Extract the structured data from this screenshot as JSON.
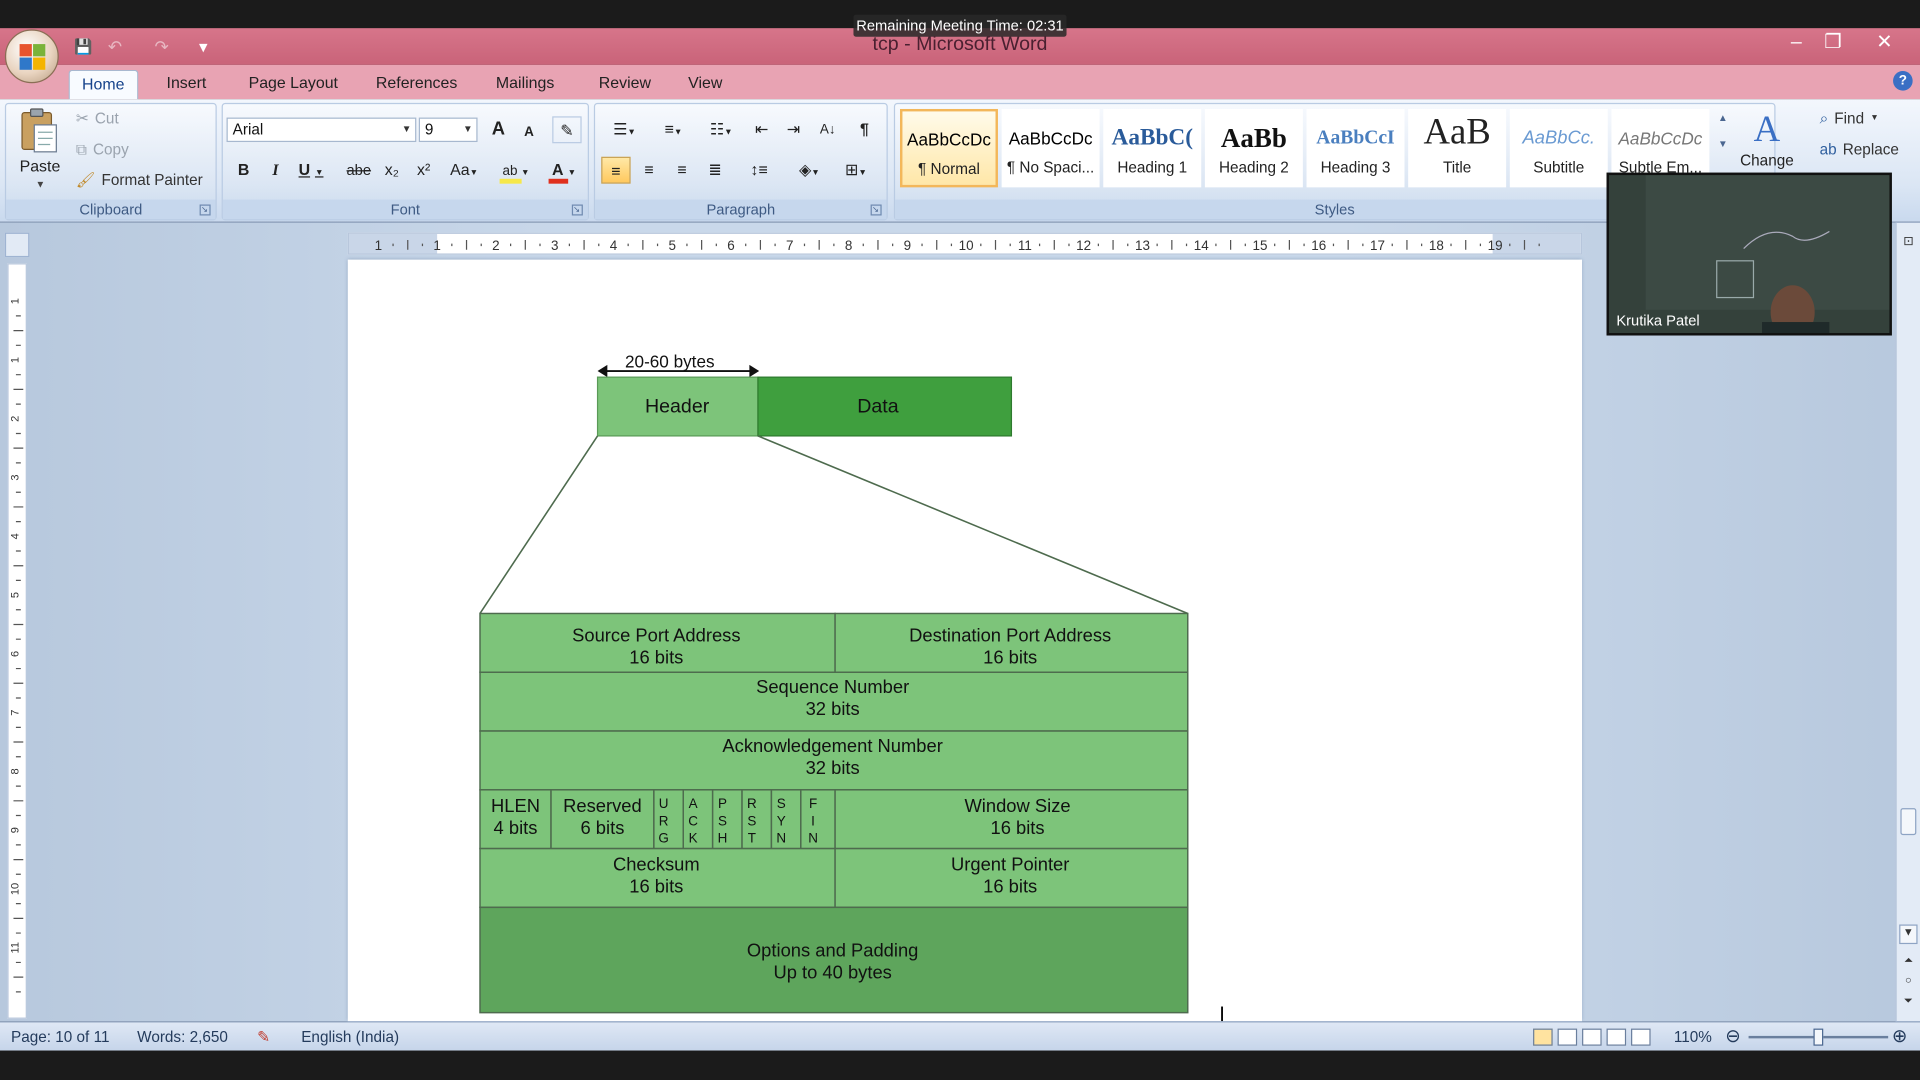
{
  "meeting": {
    "banner": "Remaining Meeting Time: 02:31",
    "participant": "Krutika Patel"
  },
  "window": {
    "title": "tcp - Microsoft Word",
    "minimize": "–",
    "restore": "❐",
    "close": "✕"
  },
  "qat": {
    "save": "💾",
    "undo": "↶",
    "redo": "↷",
    "customize": "▾"
  },
  "tabs": [
    "Home",
    "Insert",
    "Page Layout",
    "References",
    "Mailings",
    "Review",
    "View"
  ],
  "clipboard": {
    "paste": "Paste",
    "cut": "Cut",
    "copy": "Copy",
    "format_painter": "Format Painter",
    "label": "Clipboard"
  },
  "font": {
    "name": "Arial",
    "size": "9",
    "label": "Font",
    "bold": "B",
    "italic": "I",
    "underline": "U",
    "strike": "abe",
    "sub": "x₂",
    "sup": "x²",
    "case": "Aa",
    "grow": "A",
    "shrink": "A",
    "highlight_color": "#f6e84a",
    "font_color": "#e0301e"
  },
  "paragraph": {
    "label": "Paragraph"
  },
  "styles": {
    "label": "Styles",
    "items": [
      {
        "sample": "AaBbCcDc",
        "name": "¶ Normal",
        "selected": true
      },
      {
        "sample": "AaBbCcDc",
        "name": "¶ No Spaci...",
        "selected": false
      },
      {
        "sample": "AaBbC(",
        "name": "Heading 1",
        "selected": false
      },
      {
        "sample": "AaBb",
        "name": "Heading 2",
        "selected": false
      },
      {
        "sample": "AaBbCcI",
        "name": "Heading 3",
        "selected": false
      },
      {
        "sample": "AaB",
        "name": "Title",
        "selected": false
      },
      {
        "sample": "AaBbCc.",
        "name": "Subtitle",
        "selected": false
      },
      {
        "sample": "AaBbCcDc",
        "name": "Subtle Em...",
        "selected": false
      }
    ],
    "change": "Change"
  },
  "editing": {
    "find": "Find",
    "replace": "Replace"
  },
  "ruler": {
    "h_ticks": [
      "1",
      "1",
      "2",
      "3",
      "4",
      "5",
      "6",
      "7",
      "8",
      "9",
      "10",
      "11",
      "12",
      "13",
      "14",
      "15",
      "16",
      "17",
      "18",
      "19"
    ],
    "v_ticks": [
      "1",
      "1",
      "2",
      "3",
      "4",
      "5",
      "6",
      "7",
      "8",
      "9",
      "10",
      "11"
    ]
  },
  "diagram": {
    "size_label": "20-60 bytes",
    "header": "Header",
    "data": "Data",
    "fields": {
      "src_port": {
        "name": "Source Port Address",
        "bits": "16 bits"
      },
      "dst_port": {
        "name": "Destination Port Address",
        "bits": "16 bits"
      },
      "seq": {
        "name": "Sequence Number",
        "bits": "32 bits"
      },
      "ack": {
        "name": "Acknowledgement Number",
        "bits": "32 bits"
      },
      "hlen": {
        "name": "HLEN",
        "bits": "4 bits"
      },
      "reserved": {
        "name": "Reserved",
        "bits": "6 bits"
      },
      "flags": [
        {
          "letters": [
            "U",
            "R",
            "G"
          ]
        },
        {
          "letters": [
            "A",
            "C",
            "K"
          ]
        },
        {
          "letters": [
            "P",
            "S",
            "H"
          ]
        },
        {
          "letters": [
            "R",
            "S",
            "T"
          ]
        },
        {
          "letters": [
            "S",
            "Y",
            "N"
          ]
        },
        {
          "letters": [
            "F",
            "I",
            "N"
          ]
        }
      ],
      "window": {
        "name": "Window Size",
        "bits": "16 bits"
      },
      "checksum": {
        "name": "Checksum",
        "bits": "16 bits"
      },
      "urgent": {
        "name": "Urgent Pointer",
        "bits": "16 bits"
      },
      "options": {
        "name": "Options and Padding",
        "bits": "Up to 40 bytes"
      }
    },
    "colors": {
      "light_green": "#7dc47a",
      "data_green": "#3f9f3e",
      "options_green": "#5ea55c",
      "line": "#4e6b4e"
    }
  },
  "status": {
    "page": "Page: 10 of 11",
    "words": "Words: 2,650",
    "language": "English (India)",
    "zoom": "110%"
  }
}
